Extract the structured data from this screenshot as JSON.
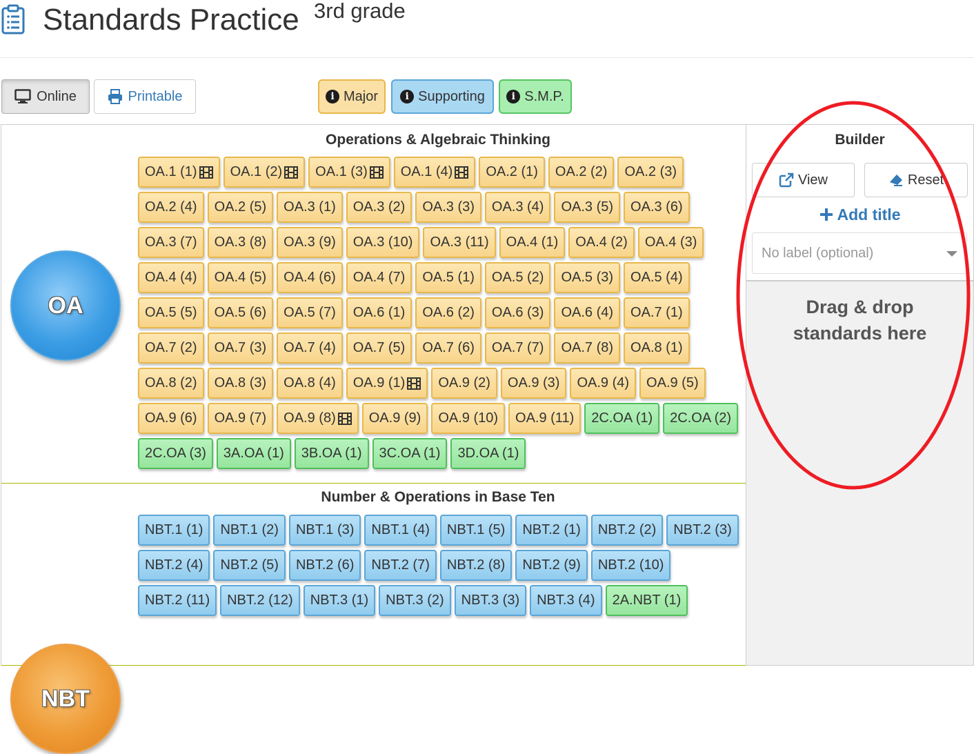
{
  "header": {
    "title": "Standards Practice",
    "subtitle": "3rd grade"
  },
  "toolbar": {
    "online_label": "Online",
    "printable_label": "Printable"
  },
  "legend": {
    "major": "Major",
    "supporting": "Supporting",
    "smp": "S.M.P."
  },
  "colors": {
    "major": "#f8d48a",
    "supporting": "#90cbee",
    "smp": "#96e59e",
    "link": "#337ab7",
    "annotation": "#ee1c24"
  },
  "sections": [
    {
      "id": "oa",
      "badge": "OA",
      "title": "Operations & Algebraic Thinking",
      "standards": [
        {
          "label": "OA.1 (1)",
          "type": "major",
          "video": true
        },
        {
          "label": "OA.1 (2)",
          "type": "major",
          "video": true
        },
        {
          "label": "OA.1 (3)",
          "type": "major",
          "video": true
        },
        {
          "label": "OA.1 (4)",
          "type": "major",
          "video": true
        },
        {
          "label": "OA.2 (1)",
          "type": "major"
        },
        {
          "label": "OA.2 (2)",
          "type": "major"
        },
        {
          "label": "OA.2 (3)",
          "type": "major"
        },
        {
          "label": "OA.2 (4)",
          "type": "major"
        },
        {
          "label": "OA.2 (5)",
          "type": "major"
        },
        {
          "label": "OA.3 (1)",
          "type": "major"
        },
        {
          "label": "OA.3 (2)",
          "type": "major"
        },
        {
          "label": "OA.3 (3)",
          "type": "major"
        },
        {
          "label": "OA.3 (4)",
          "type": "major"
        },
        {
          "label": "OA.3 (5)",
          "type": "major"
        },
        {
          "label": "OA.3 (6)",
          "type": "major"
        },
        {
          "label": "OA.3 (7)",
          "type": "major"
        },
        {
          "label": "OA.3 (8)",
          "type": "major"
        },
        {
          "label": "OA.3 (9)",
          "type": "major"
        },
        {
          "label": "OA.3 (10)",
          "type": "major"
        },
        {
          "label": "OA.3 (11)",
          "type": "major"
        },
        {
          "label": "OA.4 (1)",
          "type": "major"
        },
        {
          "label": "OA.4 (2)",
          "type": "major"
        },
        {
          "label": "OA.4 (3)",
          "type": "major"
        },
        {
          "label": "OA.4 (4)",
          "type": "major"
        },
        {
          "label": "OA.4 (5)",
          "type": "major"
        },
        {
          "label": "OA.4 (6)",
          "type": "major"
        },
        {
          "label": "OA.4 (7)",
          "type": "major"
        },
        {
          "label": "OA.5 (1)",
          "type": "major"
        },
        {
          "label": "OA.5 (2)",
          "type": "major"
        },
        {
          "label": "OA.5 (3)",
          "type": "major"
        },
        {
          "label": "OA.5 (4)",
          "type": "major"
        },
        {
          "label": "OA.5 (5)",
          "type": "major"
        },
        {
          "label": "OA.5 (6)",
          "type": "major"
        },
        {
          "label": "OA.5 (7)",
          "type": "major"
        },
        {
          "label": "OA.6 (1)",
          "type": "major"
        },
        {
          "label": "OA.6 (2)",
          "type": "major"
        },
        {
          "label": "OA.6 (3)",
          "type": "major"
        },
        {
          "label": "OA.6 (4)",
          "type": "major"
        },
        {
          "label": "OA.7 (1)",
          "type": "major"
        },
        {
          "label": "OA.7 (2)",
          "type": "major"
        },
        {
          "label": "OA.7 (3)",
          "type": "major"
        },
        {
          "label": "OA.7 (4)",
          "type": "major"
        },
        {
          "label": "OA.7 (5)",
          "type": "major"
        },
        {
          "label": "OA.7 (6)",
          "type": "major"
        },
        {
          "label": "OA.7 (7)",
          "type": "major"
        },
        {
          "label": "OA.7 (8)",
          "type": "major"
        },
        {
          "label": "OA.8 (1)",
          "type": "major"
        },
        {
          "label": "OA.8 (2)",
          "type": "major"
        },
        {
          "label": "OA.8 (3)",
          "type": "major"
        },
        {
          "label": "OA.8 (4)",
          "type": "major"
        },
        {
          "label": "OA.9 (1)",
          "type": "major",
          "video": true
        },
        {
          "label": "OA.9 (2)",
          "type": "major"
        },
        {
          "label": "OA.9 (3)",
          "type": "major"
        },
        {
          "label": "OA.9 (4)",
          "type": "major"
        },
        {
          "label": "OA.9 (5)",
          "type": "major"
        },
        {
          "label": "OA.9 (6)",
          "type": "major"
        },
        {
          "label": "OA.9 (7)",
          "type": "major"
        },
        {
          "label": "OA.9 (8)",
          "type": "major",
          "video": true
        },
        {
          "label": "OA.9 (9)",
          "type": "major"
        },
        {
          "label": "OA.9 (10)",
          "type": "major"
        },
        {
          "label": "OA.9 (11)",
          "type": "major"
        },
        {
          "label": "2C.OA (1)",
          "type": "smp"
        },
        {
          "label": "2C.OA (2)",
          "type": "smp"
        },
        {
          "label": "2C.OA (3)",
          "type": "smp"
        },
        {
          "label": "3A.OA (1)",
          "type": "smp"
        },
        {
          "label": "3B.OA (1)",
          "type": "smp"
        },
        {
          "label": "3C.OA (1)",
          "type": "smp"
        },
        {
          "label": "3D.OA (1)",
          "type": "smp"
        }
      ]
    },
    {
      "id": "nbt",
      "badge": "NBT",
      "title": "Number & Operations in Base Ten",
      "standards": [
        {
          "label": "NBT.1 (1)",
          "type": "supporting"
        },
        {
          "label": "NBT.1 (2)",
          "type": "supporting"
        },
        {
          "label": "NBT.1 (3)",
          "type": "supporting"
        },
        {
          "label": "NBT.1 (4)",
          "type": "supporting"
        },
        {
          "label": "NBT.1 (5)",
          "type": "supporting"
        },
        {
          "label": "NBT.2 (1)",
          "type": "supporting"
        },
        {
          "label": "NBT.2 (2)",
          "type": "supporting"
        },
        {
          "label": "NBT.2 (3)",
          "type": "supporting"
        },
        {
          "label": "NBT.2 (4)",
          "type": "supporting"
        },
        {
          "label": "NBT.2 (5)",
          "type": "supporting"
        },
        {
          "label": "NBT.2 (6)",
          "type": "supporting"
        },
        {
          "label": "NBT.2 (7)",
          "type": "supporting"
        },
        {
          "label": "NBT.2 (8)",
          "type": "supporting"
        },
        {
          "label": "NBT.2 (9)",
          "type": "supporting"
        },
        {
          "label": "NBT.2 (10)",
          "type": "supporting"
        },
        {
          "label": "NBT.2 (11)",
          "type": "supporting"
        },
        {
          "label": "NBT.2 (12)",
          "type": "supporting"
        },
        {
          "label": "NBT.3 (1)",
          "type": "supporting"
        },
        {
          "label": "NBT.3 (2)",
          "type": "supporting"
        },
        {
          "label": "NBT.3 (3)",
          "type": "supporting"
        },
        {
          "label": "NBT.3 (4)",
          "type": "supporting"
        },
        {
          "label": "2A.NBT (1)",
          "type": "smp"
        }
      ]
    }
  ],
  "builder": {
    "title": "Builder",
    "view_label": "View",
    "reset_label": "Reset",
    "add_title_label": "Add title",
    "label_placeholder": "No label (optional)",
    "dropzone_line1": "Drag & drop",
    "dropzone_line2": "standards here"
  }
}
